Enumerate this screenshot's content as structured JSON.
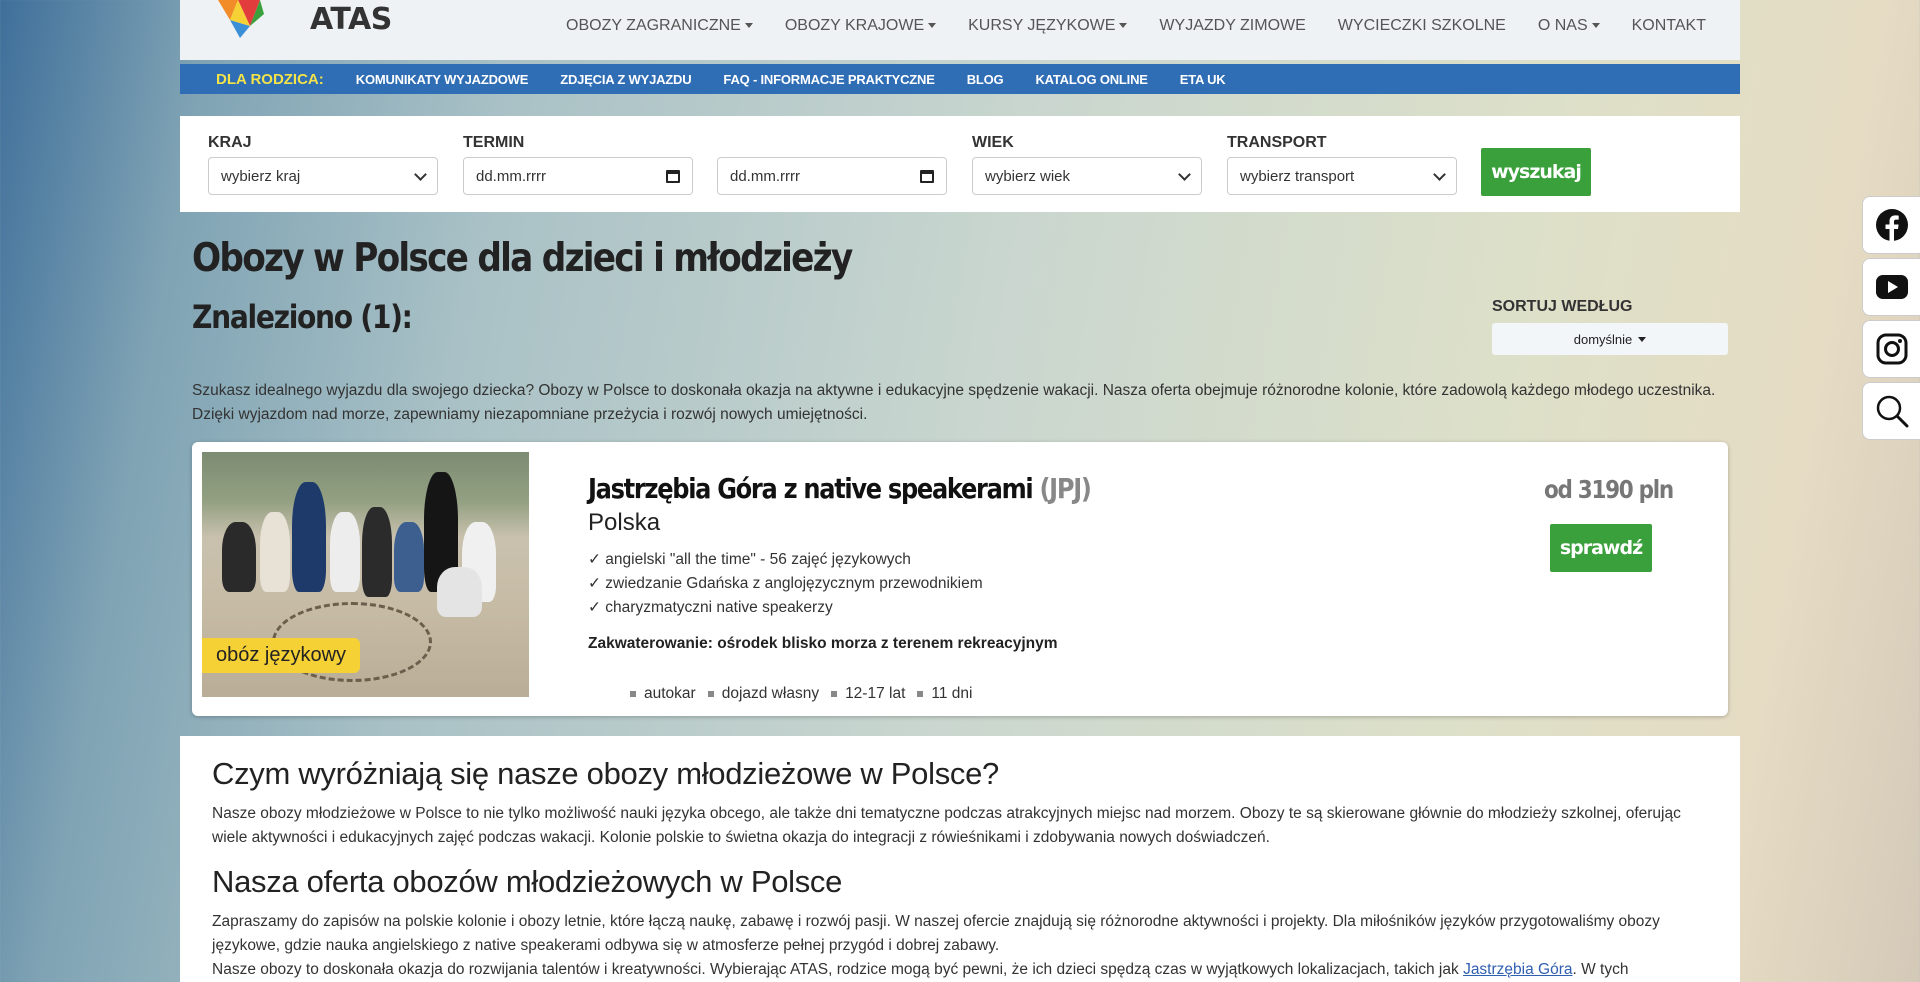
{
  "header": {
    "logo_text": "ATAS",
    "contact": "",
    "nav": [
      {
        "label": "OBOZY ZAGRANICZNE",
        "dropdown": true
      },
      {
        "label": "OBOZY KRAJOWE",
        "dropdown": true
      },
      {
        "label": "KURSY JĘZYKOWE",
        "dropdown": true
      },
      {
        "label": "WYJAZDY ZIMOWE",
        "dropdown": false
      },
      {
        "label": "WYCIECZKI SZKOLNE",
        "dropdown": false
      },
      {
        "label": "O NAS",
        "dropdown": true
      },
      {
        "label": "KONTAKT",
        "dropdown": false
      }
    ]
  },
  "subnav": {
    "lead": "DLA RODZICA:",
    "items": [
      "KOMUNIKATY WYJAZDOWE",
      "ZDJĘCIA Z WYJAZDU",
      "FAQ - INFORMACJE PRAKTYCZNE",
      "BLOG",
      "KATALOG ONLINE",
      "ETA UK"
    ]
  },
  "search": {
    "country_label": "KRAJ",
    "country_value": "wybierz kraj",
    "term_label": "TERMIN",
    "date_from": "dd.mm.rrrr",
    "date_to": "dd.mm.rrrr",
    "age_label": "WIEK",
    "age_value": "wybierz wiek",
    "transport_label": "TRANSPORT",
    "transport_value": "wybierz transport",
    "button": "wyszukaj"
  },
  "page": {
    "title": "Obozy w Polsce dla dzieci i młodzieży",
    "found": "Znaleziono (1):",
    "sort_label": "SORTUJ WEDŁUG",
    "sort_value": "domyślnie",
    "intro": "Szukasz idealnego wyjazdu dla swojego dziecka? Obozy w Polsce to doskonała okazja na aktywne i edukacyjne spędzenie wakacji. Nasza oferta obejmuje różnorodne kolonie, które zadowolą każdego młodego uczestnika. Dzięki wyjazdom nad morze, zapewniamy niezapomniane przeżycia i rozwój nowych umiejętności."
  },
  "offer": {
    "badge": "obóz językowy",
    "title": "Jastrzębia Góra z native speakerami",
    "code": "(JPJ)",
    "country": "Polska",
    "features": [
      "✓ angielski \"all the time\" - 56 zajęć językowych",
      "✓ zwiedzanie Gdańska z anglojęzycznym przewodnikiem",
      "✓ charyzmatyczni native speakerzy"
    ],
    "lodging": "Zakwaterowanie: ośrodek blisko morza z terenem rekreacyjnym",
    "tags": [
      "autokar",
      "dojazd własny",
      "12-17 lat",
      "11 dni"
    ],
    "price": "od 3190 pln",
    "button": "sprawdź"
  },
  "content": {
    "h_1": "Czym wyróżniają się nasze obozy młodzieżowe w Polsce?",
    "p_1": "Nasze obozy młodzieżowe w Polsce to nie tylko możliwość nauki języka obcego, ale także dni tematyczne podczas atrakcyjnych miejsc nad morzem. Obozy te są skierowane głównie do młodzieży szkolnej, oferując wiele aktywności i edukacyjnych zajęć podczas wakacji. Kolonie polskie to świetna okazja do integracji z rówieśnikami i zdobywania nowych doświadczeń.",
    "h_2": "Nasza oferta obozów młodzieżowych w Polsce",
    "p_2": "Zapraszamy do zapisów na polskie kolonie i obozy letnie, które łączą naukę, zabawę i rozwój pasji. W naszej ofercie znajdują się różnorodne aktywności i projekty. Dla miłośników języków przygotowaliśmy obozy językowe, gdzie nauka angielskiego z native speakerami odbywa się w atmosferze pełnej przygód i dobrej zabawy.",
    "p_3_start": "Nasze obozy to doskonała okazja do rozwijania talentów i kreatywności. Wybierając ATAS, rodzice mogą być pewni, że ich dzieci spędzą czas w wyjątkowych lokalizacjach, takich jak ",
    "p_3_link": "Jastrzębia Góra",
    "p_3_end": ". W tych"
  },
  "colors": {
    "subnav_blue": "#2f6db5",
    "accent_green": "#3aa03c",
    "badge_yellow": "#f6d135",
    "lead_yellow": "#f3e34a"
  },
  "social": [
    "facebook-icon",
    "youtube-icon",
    "instagram-icon",
    "search-icon"
  ]
}
